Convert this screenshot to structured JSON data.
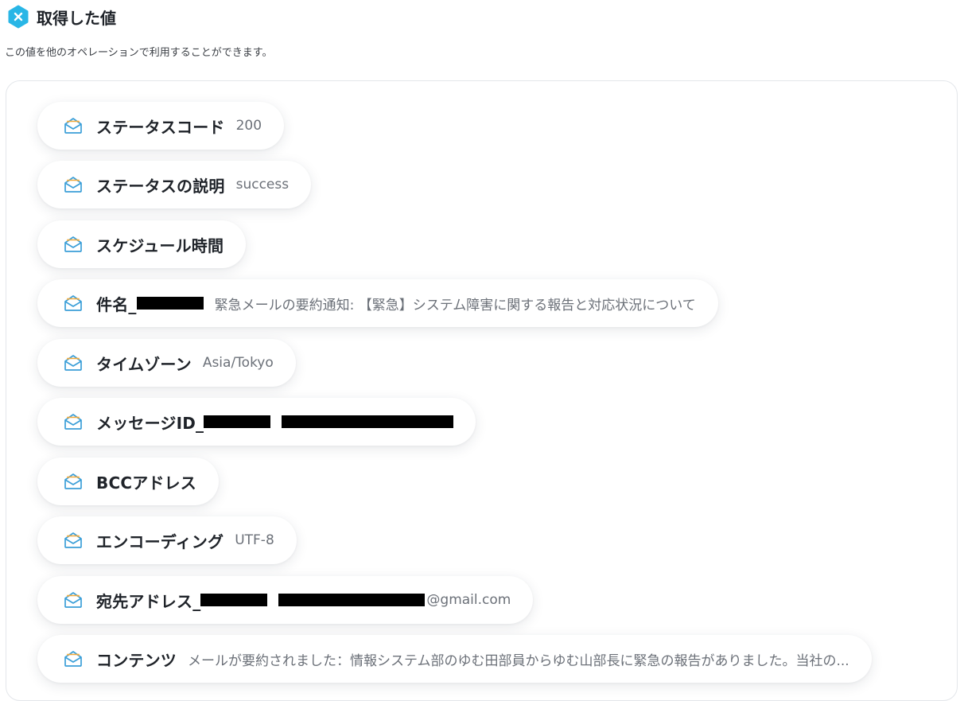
{
  "header": {
    "title": "取得した値",
    "icon": "x-badge-icon",
    "icon_color": "#29b6e6"
  },
  "description": "この値を他のオペレーションで利用することができます。",
  "accent_color": "#3b9fd8",
  "items": [
    {
      "label": "ステータスコード",
      "value": "200",
      "icon": "mail-open-icon"
    },
    {
      "label": "ステータスの説明",
      "value": "success",
      "icon": "mail-open-icon"
    },
    {
      "label": "スケジュール時間",
      "value": "",
      "icon": "mail-open-icon"
    },
    {
      "label": "件名_",
      "value": "緊急メールの要約通知: 【緊急】システム障害に関する報告と対応状況について",
      "icon": "mail-open-icon",
      "redacted": true
    },
    {
      "label": "タイムゾーン",
      "value": "Asia/Tokyo",
      "icon": "mail-open-icon"
    },
    {
      "label": "メッセージID_",
      "value": "",
      "icon": "mail-open-icon",
      "redacted": true
    },
    {
      "label": "BCCアドレス",
      "value": "",
      "icon": "mail-open-icon"
    },
    {
      "label": "エンコーディング",
      "value": "UTF-8",
      "icon": "mail-open-icon"
    },
    {
      "label": "宛先アドレス_",
      "value": "@gmail.com",
      "icon": "mail-open-icon",
      "redacted": true
    },
    {
      "label": "コンテンツ",
      "value": "メールが要約されました：情報システム部のゆむ田部員からゆむ山部長に緊急の報告がありました。当社の...",
      "icon": "mail-open-icon"
    }
  ]
}
